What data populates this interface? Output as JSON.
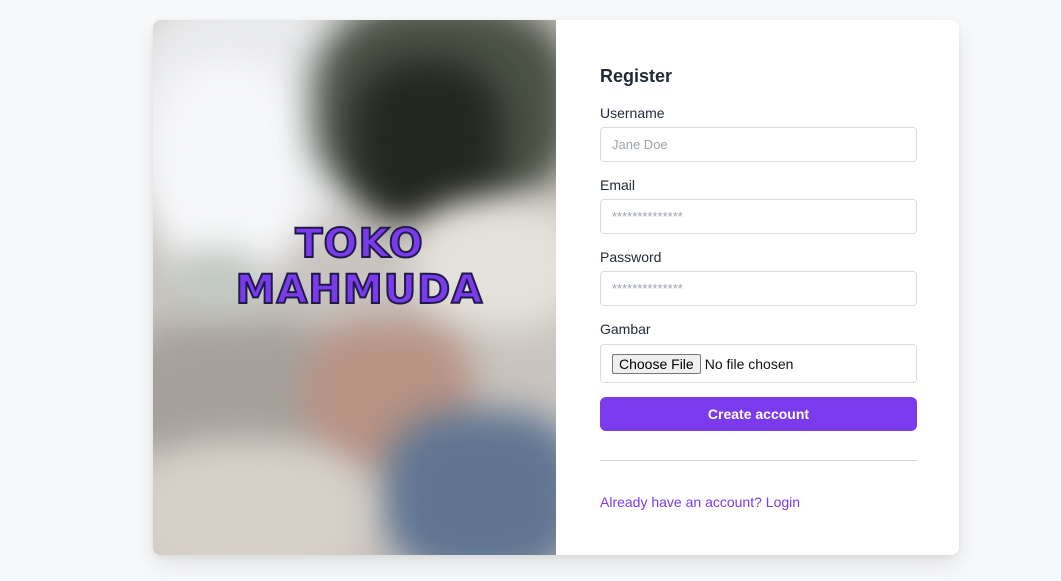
{
  "hero": {
    "brand_line1": "TOKO",
    "brand_line2": "MAHMUDA"
  },
  "form": {
    "title": "Register",
    "username": {
      "label": "Username",
      "placeholder": "Jane Doe"
    },
    "email": {
      "label": "Email",
      "placeholder": "**************"
    },
    "password": {
      "label": "Password",
      "placeholder": "**************"
    },
    "image": {
      "label": "Gambar",
      "button": "Choose File",
      "status": "No file chosen"
    },
    "submit_label": "Create account",
    "login_link": "Already have an account? Login"
  },
  "colors": {
    "accent": "#7c3aed",
    "page_bg": "#f8f9fb",
    "brand_outline": "#1e1b4b"
  }
}
